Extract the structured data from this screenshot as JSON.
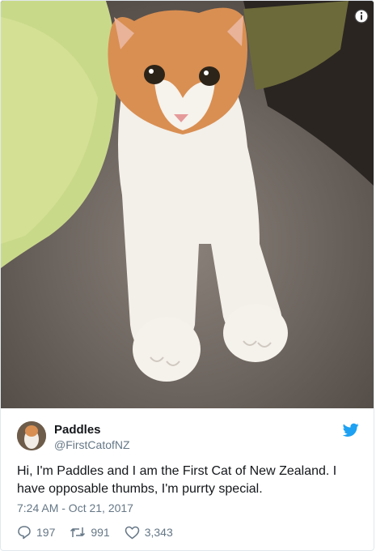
{
  "tweet": {
    "author_name": "Paddles",
    "author_handle": "@FirstCatofNZ",
    "text": "Hi, I'm Paddles and I am the First Cat of New Zealand. I have opposable thumbs, I'm purrty special.",
    "timestamp": "7:24 AM - Oct 21, 2017",
    "replies": "197",
    "retweets": "991",
    "likes": "3,343"
  },
  "icons": {
    "info": "info-icon",
    "brand": "twitter-bird-icon",
    "reply": "reply-icon",
    "retweet": "retweet-icon",
    "like": "heart-icon"
  },
  "colors": {
    "brand_blue": "#1da1f2",
    "muted_text": "#657786",
    "text": "#14171a"
  }
}
